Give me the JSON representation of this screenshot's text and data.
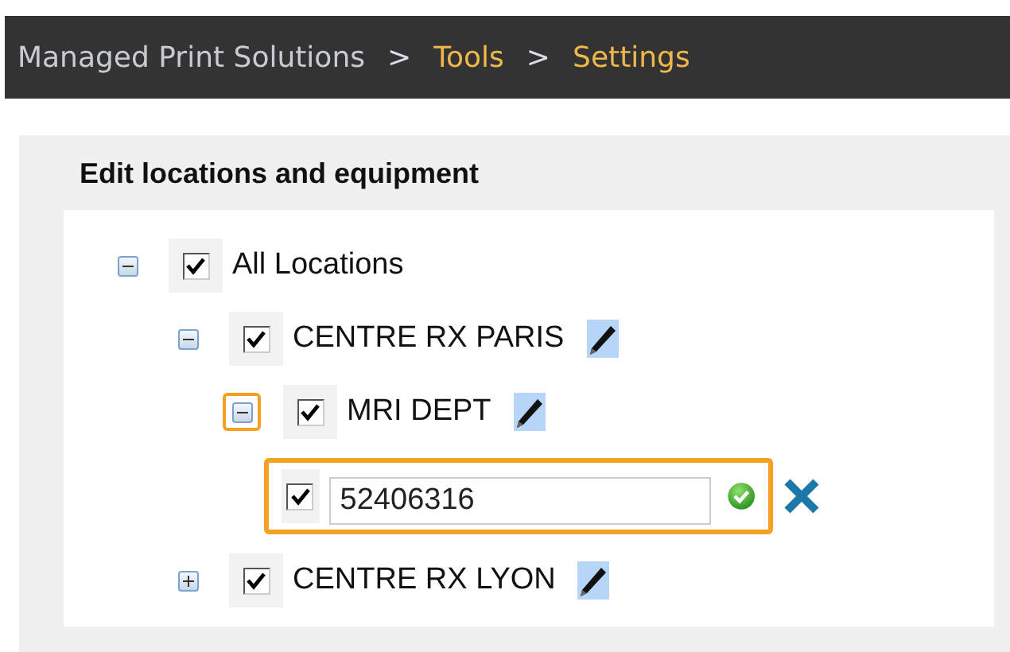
{
  "breadcrumb": {
    "separator": ">",
    "items": [
      {
        "label": "Managed Print Solutions",
        "kind": "root"
      },
      {
        "label": "Tools",
        "kind": "link"
      },
      {
        "label": "Settings",
        "kind": "link"
      }
    ]
  },
  "panel": {
    "title": "Edit locations and equipment",
    "tree": [
      {
        "kind": "node",
        "label": "All Locations",
        "expanded": true,
        "checked": true,
        "editable": false,
        "focused": false,
        "children": [
          {
            "kind": "node",
            "label": "CENTRE RX PARIS",
            "expanded": true,
            "checked": true,
            "editable": true,
            "focused": false,
            "children": [
              {
                "kind": "node",
                "label": "MRI DEPT",
                "expanded": true,
                "checked": true,
                "editable": true,
                "focused": true,
                "children": [
                  {
                    "kind": "editor",
                    "value": "52406316",
                    "checked": true,
                    "focused": true
                  }
                ]
              }
            ]
          },
          {
            "kind": "node",
            "label": "CENTRE RX LYON",
            "expanded": false,
            "checked": true,
            "editable": true,
            "focused": false
          }
        ]
      }
    ]
  }
}
